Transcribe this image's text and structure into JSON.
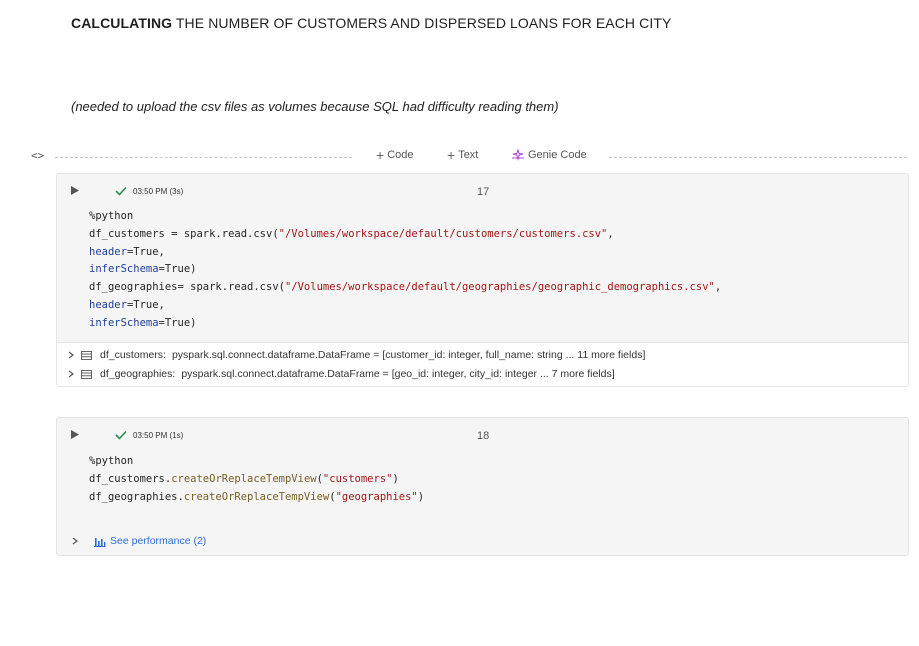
{
  "markdown": {
    "title_bold": "CALCULATING",
    "title_rest": " THE NUMBER OF CUSTOMERS AND DISPERSED LOANS FOR EACH CITY",
    "note": "(needed to upload the csv files as volumes because SQL had difficulty reading them)"
  },
  "insert_bar": {
    "toggle": "<>",
    "code_label": "Code",
    "text_label": "Text",
    "genie_label": "Genie Code"
  },
  "cells": [
    {
      "status": "03:50 PM (3s)",
      "number": "17",
      "code": {
        "l1": "%python",
        "l2a": "df_customers = spark.read.csv(",
        "l2s": "\"/Volumes/workspace/default/customers/customers.csv\"",
        "l2b": ",",
        "l3k": "header",
        "l3v": "=True,",
        "l4k": "inferSchema",
        "l4v": "=True)",
        "l5a": "df_geographies= spark.read.csv(",
        "l5s": "\"/Volumes/workspace/default/geographies/geographic_demographics.csv\"",
        "l5b": ",",
        "l6k": "header",
        "l6v": "=True,",
        "l7k": "inferSchema",
        "l7v": "=True)"
      },
      "outputs": [
        {
          "name": "df_customers:",
          "type": "pyspark.sql.connect.dataframe.DataFrame = [customer_id: integer, full_name: string ... 11 more fields]"
        },
        {
          "name": "df_geographies:",
          "type": "pyspark.sql.connect.dataframe.DataFrame = [geo_id: integer, city_id: integer ... 7 more fields]"
        }
      ]
    },
    {
      "status": "03:50 PM (1s)",
      "number": "18",
      "code": {
        "l1": "%python",
        "l2a": "df_customers.",
        "l2f": "createOrReplaceTempView",
        "l2p": "(",
        "l2s": "\"customers\"",
        "l2b": ")",
        "l3a": "df_geographies.",
        "l3f": "createOrReplaceTempView",
        "l3p": "(",
        "l3s": "\"geographies\"",
        "l3b": ")"
      },
      "perf_label": "See performance (2)"
    }
  ],
  "colors": {
    "keyword": "#1f3f9a",
    "string": "#a31515",
    "function": "#795e26",
    "success": "#2e8b57",
    "link": "#2e6fd6"
  }
}
